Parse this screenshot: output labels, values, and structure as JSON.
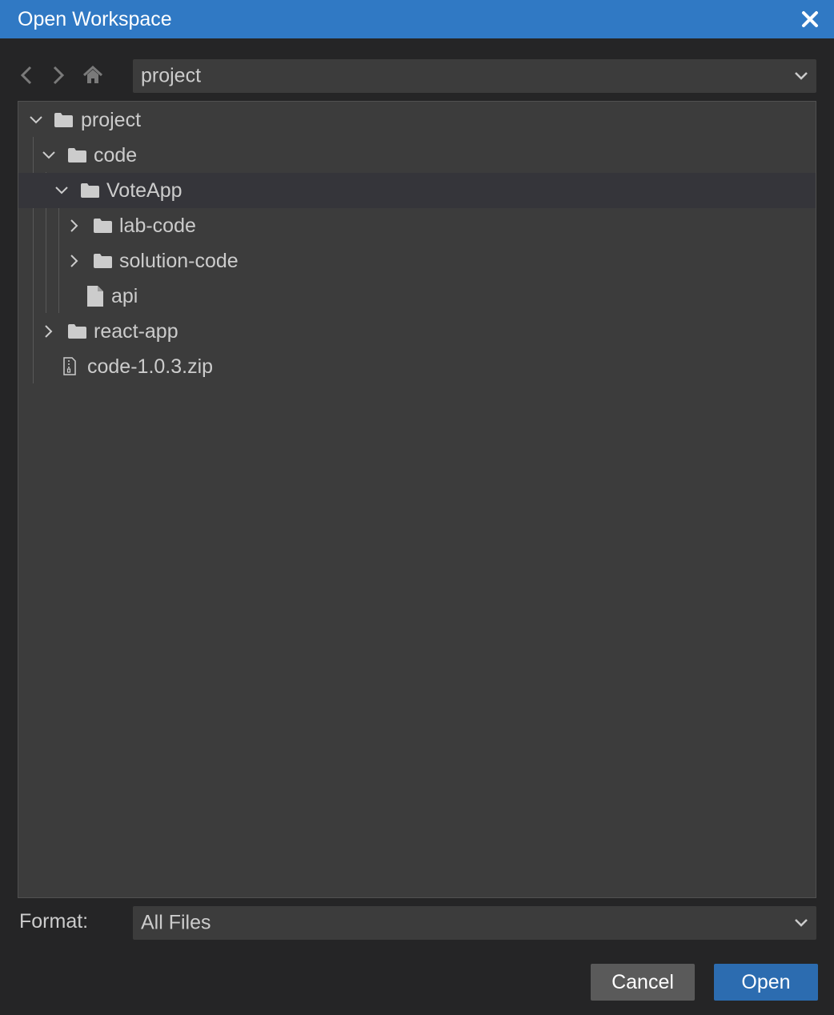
{
  "dialog": {
    "title": "Open Workspace",
    "close_icon": "close-icon",
    "accent_color": "#3079c4"
  },
  "toolbar": {
    "back_icon": "chevron-left-icon",
    "forward_icon": "chevron-right-icon",
    "home_icon": "home-icon",
    "location_value": "project"
  },
  "tree": {
    "items": [
      {
        "label": "project",
        "type": "folder",
        "expanded": true
      },
      {
        "label": "code",
        "type": "folder",
        "expanded": true
      },
      {
        "label": "VoteApp",
        "type": "folder",
        "expanded": true,
        "selected": true
      },
      {
        "label": "lab-code",
        "type": "folder",
        "expanded": false
      },
      {
        "label": "solution-code",
        "type": "folder",
        "expanded": false
      },
      {
        "label": "api",
        "type": "file"
      },
      {
        "label": "react-app",
        "type": "folder",
        "expanded": false
      },
      {
        "label": "code-1.0.3.zip",
        "type": "zip"
      }
    ]
  },
  "format": {
    "label": "Format:",
    "value": "All Files"
  },
  "buttons": {
    "cancel_label": "Cancel",
    "open_label": "Open",
    "open_color": "#2c6cb0"
  }
}
